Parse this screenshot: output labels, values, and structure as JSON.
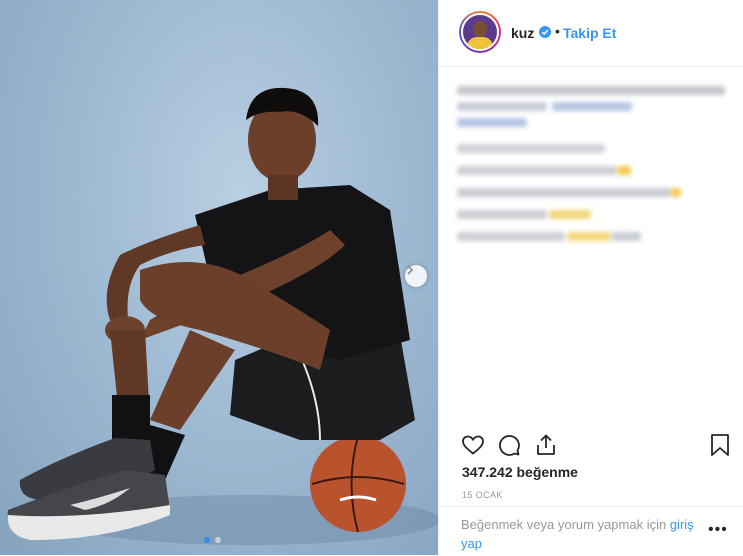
{
  "post": {
    "username": "kuz",
    "separator": "•",
    "follow_label": "Takip Et",
    "likes": "347.242 beğenme",
    "date": "15 OCAK",
    "login_prompt": "Beğenmek veya yorum yapmak için",
    "login_link": "giriş yap",
    "carousel": {
      "total": 2,
      "active": 1
    }
  },
  "colors": {
    "accent": "#3897f0",
    "highlight": "#f2c84b",
    "text": "#262626"
  },
  "icons": {
    "like": "heart-icon",
    "comment": "comment-icon",
    "share": "share-icon",
    "save": "bookmark-icon",
    "verified": "verified-badge-icon",
    "more": "more-options-icon",
    "next": "chevron-right-icon"
  }
}
